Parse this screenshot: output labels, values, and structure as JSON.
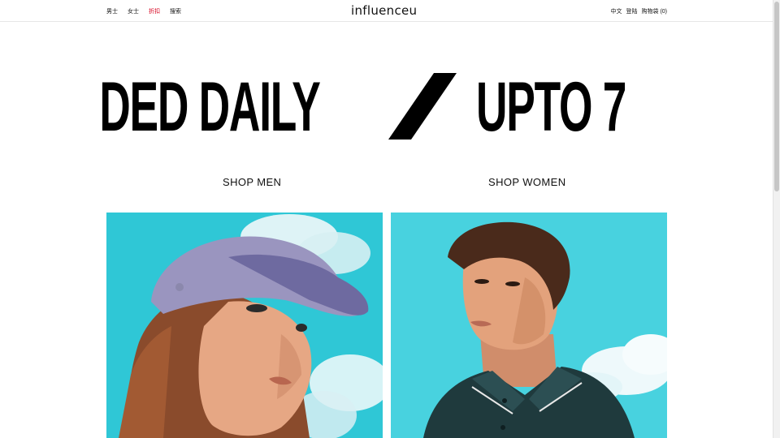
{
  "header": {
    "nav_left": [
      {
        "label": "男士"
      },
      {
        "label": "女士"
      },
      {
        "label": "折扣"
      },
      {
        "label": "搜索"
      }
    ],
    "logo": "influenceu",
    "nav_right": [
      {
        "label": "中文"
      },
      {
        "label": "登陆"
      },
      {
        "label": "购物袋 (0)"
      }
    ],
    "sale_color": "#d6001c"
  },
  "banner": {
    "text_part1": "ODED DAILY",
    "text_part2": "UPTO 7"
  },
  "shop": {
    "men_label": "SHOP MEN",
    "women_label": "SHOP WOMEN"
  },
  "colors": {
    "sky": "#35c8d6",
    "shirt": "#1f3a3d"
  }
}
